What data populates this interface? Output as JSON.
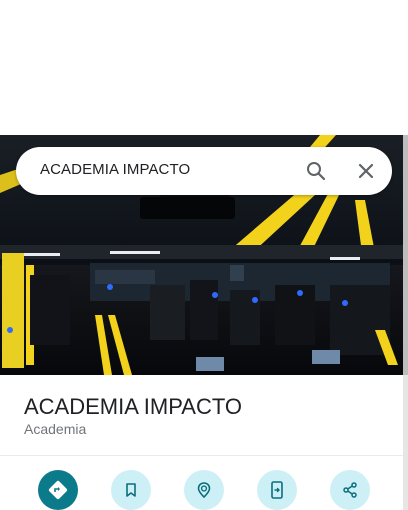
{
  "search": {
    "query": "ACADEMIA IMPACTO"
  },
  "place": {
    "name": "ACADEMIA IMPACTO",
    "category": "Academia"
  },
  "actions": [
    {
      "icon": "directions-icon",
      "style": "primary"
    },
    {
      "icon": "bookmark-icon",
      "style": "secondary"
    },
    {
      "icon": "nearby-icon",
      "style": "secondary"
    },
    {
      "icon": "send-to-phone-icon",
      "style": "secondary"
    },
    {
      "icon": "share-icon",
      "style": "secondary"
    }
  ],
  "colors": {
    "primary_action": "#0b7a8a",
    "secondary_action": "#cdeff6",
    "icon_dark": "#0b6f7c",
    "hero_accent_yellow": "#f2d21b",
    "hero_accent_blue": "#2e6bff"
  }
}
